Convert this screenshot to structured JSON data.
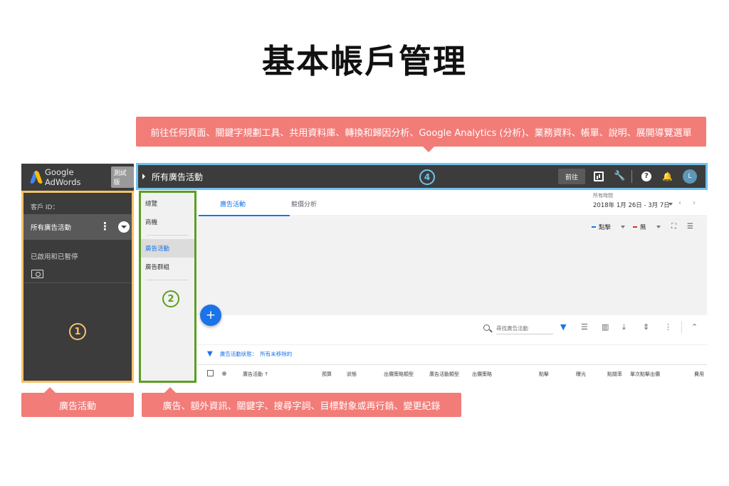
{
  "page_title": "基本帳戶管理",
  "callouts": {
    "top": "前往任何頁面、關鍵字規劃工具、共用資料庫、轉換和歸因分析、Google Analytics (分析)、業務資料、帳單、說明、展開導覽選單",
    "left": "廣告活動",
    "middle": "廣告、額外資訊、關鍵字、搜尋字詞、目標對象或再行銷、變更紀錄"
  },
  "badges": {
    "one": "1",
    "two": "2",
    "four": "4"
  },
  "logo": {
    "text": "Google AdWords",
    "badge": "測試版"
  },
  "left_panel": {
    "customer_id_label": "客戶 ID：",
    "active_item": "所有廣告活動",
    "paused_label": "已啟用和已暫停"
  },
  "top_bar": {
    "title": "所有廣告活動",
    "goto_label": "前往",
    "avatar_initial": "L"
  },
  "mid_nav": {
    "items": [
      "總覽",
      "商機",
      "廣告活動",
      "廣告群組"
    ]
  },
  "main": {
    "tabs": [
      "廣告活動",
      "競價分析"
    ],
    "date_range_label": "所有時間",
    "date_range_value": "2018年 1月 26日 - 3月 7日",
    "metric_1": "點擊",
    "metric_2": "無",
    "add_button": "+",
    "search_placeholder": "尋找廣告活動",
    "filter_label": "廣告活動狀態：",
    "filter_value": "所有未移除的",
    "columns": [
      "廣告活動",
      "預算",
      "狀態",
      "出價策略類型",
      "廣告活動類型",
      "出價策略",
      "點擊",
      "曝光",
      "點閱率",
      "單次點擊出價",
      "費用"
    ]
  },
  "colors": {
    "left_border": "#f5c36b",
    "mid_border": "#5c9e22",
    "top_border": "#6fc2ee",
    "callout": "#f27c78",
    "accent": "#1a73e8"
  }
}
